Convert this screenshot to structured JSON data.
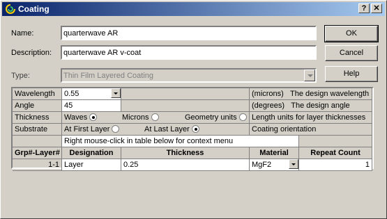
{
  "window": {
    "title": "Coating",
    "help_glyph": "?",
    "close_glyph": "✕"
  },
  "form": {
    "name_label": "Name:",
    "name_value": "quarterwave AR",
    "description_label": "Description:",
    "description_value": "quarterwave AR v-coat",
    "type_label": "Type:",
    "type_value": "Thin Film Layered Coating"
  },
  "buttons": {
    "ok": "OK",
    "cancel": "Cancel",
    "help": "Help"
  },
  "params": {
    "wavelength": {
      "label": "Wavelength",
      "value": "0.55",
      "unit": "(microns)",
      "desc": "The design wavelength"
    },
    "angle": {
      "label": "Angle",
      "value": "45",
      "unit": "(degrees)",
      "desc": "The design angle"
    },
    "thickness": {
      "label": "Thickness",
      "opt1": "Waves",
      "opt2": "Microns",
      "opt3": "Geometry units",
      "desc": "Length units for layer thicknesses",
      "selected": "Waves"
    },
    "substrate": {
      "label": "Substrate",
      "opt1": "At First Layer",
      "opt2": "At Last Layer",
      "desc": "Coating orientation",
      "selected": "At Last Layer"
    },
    "hint": "Right mouse-click in table below for context menu"
  },
  "table": {
    "headers": [
      "Grp#-Layer#",
      "Designation",
      "Thickness",
      "Material",
      "Repeat Count"
    ],
    "rows": [
      {
        "id": "1-1",
        "designation": "Layer",
        "thickness": "0.25",
        "material": "MgF2",
        "repeat": "1"
      }
    ]
  }
}
